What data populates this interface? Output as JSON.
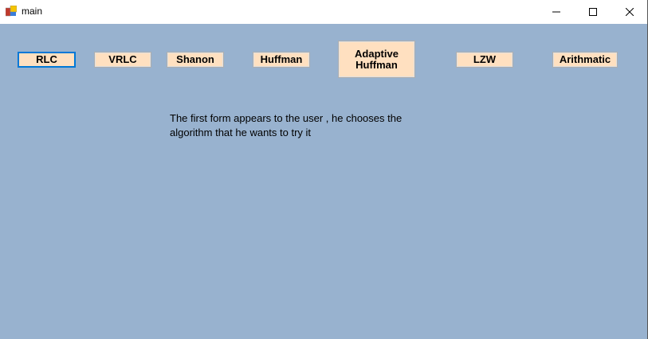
{
  "window": {
    "title": "main"
  },
  "buttons": [
    "RLC",
    "VRLC",
    "Shanon",
    "Huffman",
    "Adaptive Huffman",
    "LZW",
    "Arithmatic"
  ],
  "description": {
    "line1": "The first form appears to the user , he chooses the",
    "line2": "algorithm that he wants to try it"
  },
  "colors": {
    "background": "#98b2cf",
    "button": "#ffe0c0",
    "focus": "#0078d7"
  }
}
